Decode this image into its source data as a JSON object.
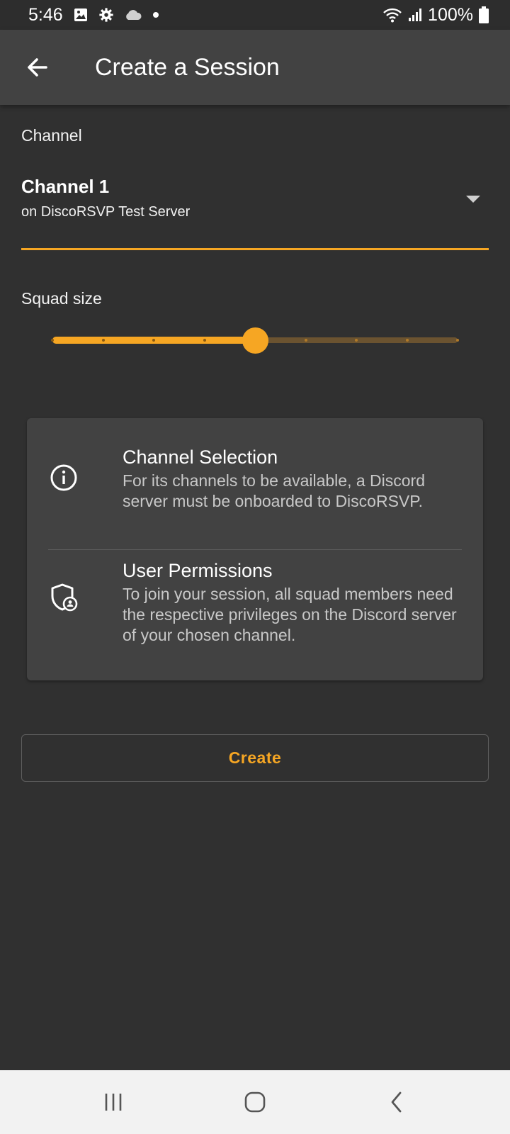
{
  "status_bar": {
    "time": "5:46",
    "battery": "100%",
    "left_icons": [
      "image-icon",
      "settings-icon",
      "cloud-icon",
      "dot-icon"
    ],
    "right_icons": [
      "wifi-icon",
      "signal-icon",
      "battery-icon"
    ]
  },
  "app_bar": {
    "title": "Create a Session",
    "back_icon": "arrow-back-icon"
  },
  "channel": {
    "label": "Channel",
    "selected_name": "Channel 1",
    "selected_server": "on DiscoRSVP Test Server"
  },
  "squad_size": {
    "label": "Squad size",
    "value_fraction": 0.5,
    "divisions": 8
  },
  "info_card": {
    "items": [
      {
        "icon": "info-icon",
        "title": "Channel Selection",
        "body": "For its channels to be available, a Discord server must be onboarded to DiscoRSVP."
      },
      {
        "icon": "shield-user-icon",
        "title": "User Permissions",
        "body": "To join your session, all squad members need the respective privileges on the Discord server of your chosen channel."
      }
    ]
  },
  "actions": {
    "create_label": "Create"
  },
  "colors": {
    "accent": "#f6a623",
    "background": "#303030",
    "app_bar": "#424242",
    "card": "#424242"
  },
  "nav_bar": {
    "icons": [
      "recent-apps-icon",
      "home-icon",
      "back-icon"
    ]
  }
}
